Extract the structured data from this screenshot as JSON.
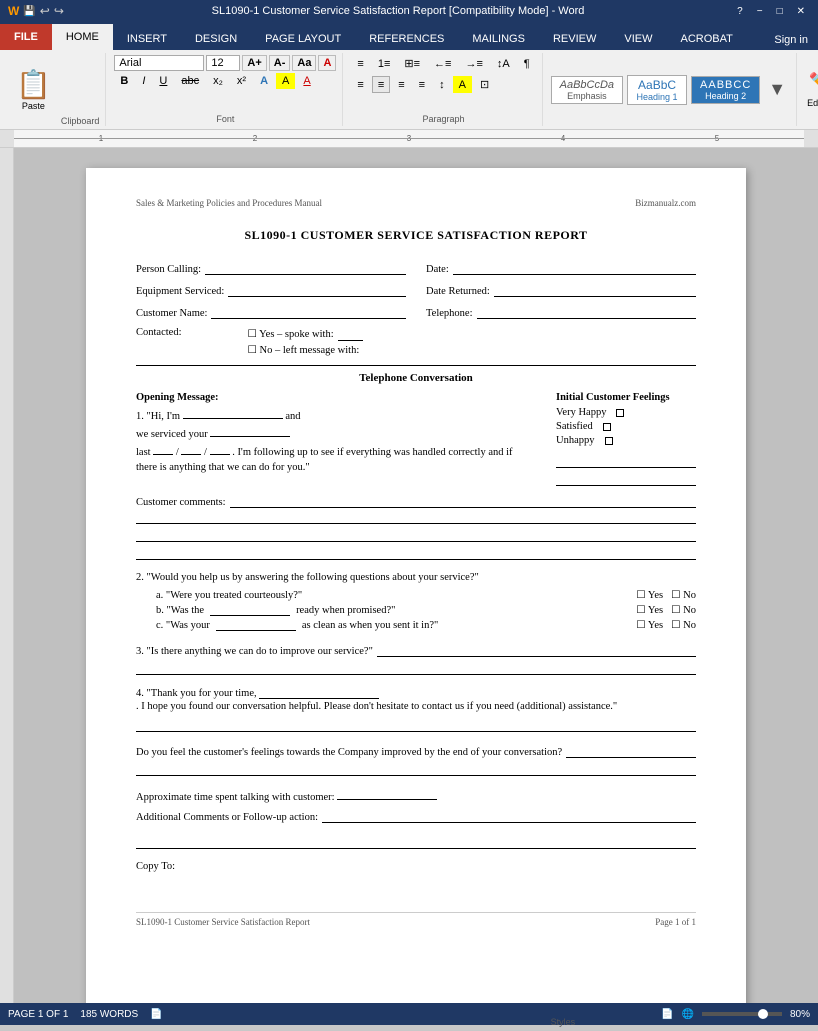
{
  "titlebar": {
    "title": "SL1090-1 Customer Service Satisfaction Report [Compatibility Mode] - Word",
    "help_icon": "?",
    "minimize": "−",
    "restore": "□",
    "close": "✕"
  },
  "tabs": {
    "file": "FILE",
    "home": "HOME",
    "insert": "INSERT",
    "design": "DESIGN",
    "page_layout": "PAGE LAYOUT",
    "references": "REFERENCES",
    "mailings": "MAILINGS",
    "review": "REVIEW",
    "view": "VIEW",
    "acrobat": "ACROBAT",
    "signin": "Sign in"
  },
  "toolbar": {
    "paste_label": "Paste",
    "clipboard_label": "Clipboard",
    "font_name": "Arial",
    "font_size": "12",
    "bold": "B",
    "italic": "I",
    "underline": "U",
    "font_label": "Font",
    "paragraph_label": "Paragraph",
    "styles_label": "Styles",
    "style_emphasis": "AaBbCcDa",
    "style_emphasis_name": "Emphasis",
    "style_heading1": "AaBbC",
    "style_heading1_name": "Heading 1",
    "style_heading2": "AABBCC",
    "style_heading2_name": "Heading 2",
    "editing_label": "Editing",
    "editing_icon": "✏"
  },
  "document": {
    "header_left": "Sales & Marketing Policies and Procedures Manual",
    "header_right": "Bizmanualz.com",
    "title": "SL1090-1 CUSTOMER SERVICE SATISFACTION REPORT",
    "person_calling_label": "Person Calling:",
    "date_label": "Date:",
    "equipment_serviced_label": "Equipment Serviced:",
    "date_returned_label": "Date Returned:",
    "customer_name_label": "Customer Name:",
    "telephone_label": "Telephone:",
    "contacted_label": "Contacted:",
    "contacted_yes": "☐ Yes – spoke with:",
    "contacted_no": "☐ No – left message with:",
    "section_title": "Telephone Conversation",
    "opening_message_label": "Opening Message:",
    "script_1_a": "1. \"Hi, I'm",
    "script_1_b": "and",
    "script_1_c": "we serviced your",
    "script_1_d": "last",
    "script_1_e": "/",
    "script_1_f": "/",
    "script_1_g": ". I'm following up to see if everything was handled correctly and if there is anything that we can do for you.\"",
    "initial_feelings_title": "Initial Customer Feelings",
    "feeling_very_happy": "Very Happy",
    "feeling_satisfied": "Satisfied",
    "feeling_unhappy": "Unhappy",
    "customer_comments_label": "Customer comments:",
    "q2_text": "2. \"Would you help us by answering the following questions about your service?\"",
    "q2a_text": "a. \"Were you treated courteously?\"",
    "q2b_text": "b. \"Was the",
    "q2b_suffix": "ready when promised?\"",
    "q2c_text": "c. \"Was your",
    "q2c_suffix": "as clean as when you sent it in?\"",
    "yes_label": "☐ Yes",
    "no_label": "☐ No",
    "q3_text": "3. \"Is there anything we can do to improve our service?\"",
    "q4_text": "4. \"Thank you for your time,",
    "q4_suffix": ". I hope you found our conversation helpful. Please don't hesitate to contact us if you need (additional) assistance.\"",
    "feelings_question": "Do you feel the customer's feelings towards the Company improved by the end of your conversation?",
    "approx_time_label": "Approximate time spent talking with customer:",
    "additional_comments_label": "Additional Comments or Follow-up action:",
    "copy_to_label": "Copy To:",
    "footer_left": "SL1090-1 Customer Service Satisfaction Report",
    "footer_right": "Page 1 of 1"
  },
  "statusbar": {
    "page_info": "PAGE 1 OF 1",
    "word_count": "185 WORDS",
    "zoom_level": "80%"
  }
}
